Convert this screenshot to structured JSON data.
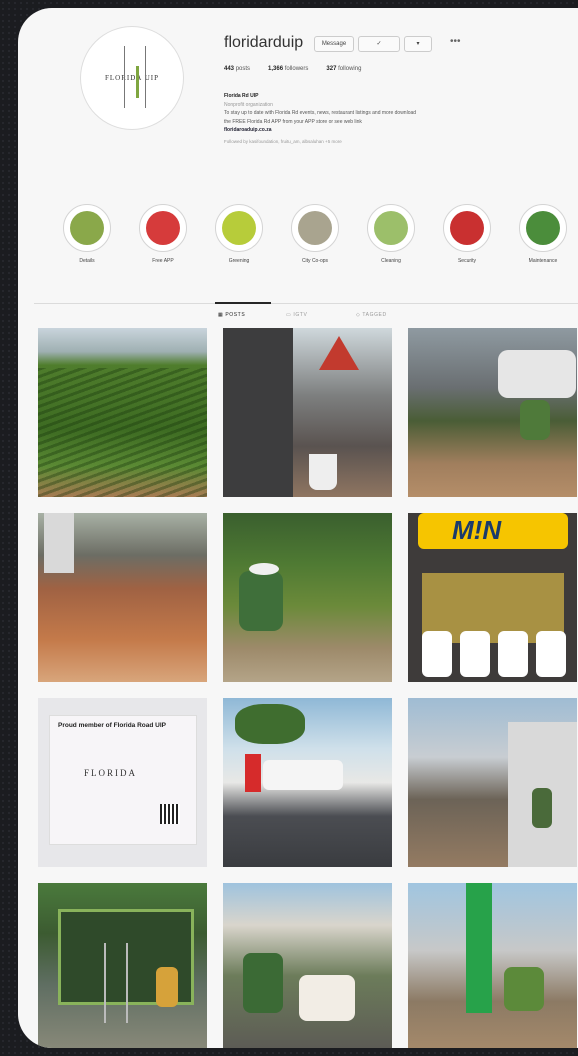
{
  "profile": {
    "username": "floridarduip",
    "message_label": "Message",
    "more_label": "•••",
    "stats": {
      "posts_count": "443",
      "posts_label": "posts",
      "followers_count": "1,366",
      "followers_label": "followers",
      "following_count": "327",
      "following_label": "following"
    },
    "name": "Florida Rd UIP",
    "category": "Nonprofit organization",
    "bio_line1": "To stay up to date with Florida Rd events, news, restaurant listings and more download",
    "bio_line2": "the FREE Florida Rd APP from your APP store or see web link",
    "link": "floridaroaduip.co.za",
    "followed_by": "Followed by kasifoundation, fruitu_am, albsaluhan +5 more"
  },
  "highlights": [
    {
      "label": "Details",
      "color": "#8aa84a",
      "icon": "building-icon"
    },
    {
      "label": "Free APP",
      "color": "#d63b3b",
      "icon": "info-icon"
    },
    {
      "label": "Greening",
      "color": "#b7cc3a",
      "icon": "leaf-icon"
    },
    {
      "label": "City Co-ops",
      "color": "#a9a48f",
      "icon": "tree-icon"
    },
    {
      "label": "Cleaning",
      "color": "#9cbf6a",
      "icon": "worker-icon"
    },
    {
      "label": "Security",
      "color": "#c93030",
      "icon": "shield-icon"
    },
    {
      "label": "Maintenance",
      "color": "#4b8d3b",
      "icon": "tools-icon"
    }
  ],
  "tabs": [
    {
      "label": "POSTS",
      "icon": "grid-icon"
    },
    {
      "label": "IGTV",
      "icon": "tv-icon"
    },
    {
      "label": "TAGGED",
      "icon": "tag-icon"
    }
  ],
  "posts": [
    {
      "name": "post-vineyard"
    },
    {
      "name": "post-street-warning-sign"
    },
    {
      "name": "post-tree-planting"
    },
    {
      "name": "post-excavation"
    },
    {
      "name": "post-paving-worker"
    },
    {
      "name": "post-mtn-store",
      "text": "M!N"
    },
    {
      "name": "post-member-sign",
      "text": "Proud member of Florida Road UIP",
      "logo": "FLORIDA"
    },
    {
      "name": "post-street-guard"
    },
    {
      "name": "post-street-sweeper"
    },
    {
      "name": "post-shelter-painting"
    },
    {
      "name": "post-planter-workers"
    },
    {
      "name": "post-green-pillar"
    }
  ]
}
